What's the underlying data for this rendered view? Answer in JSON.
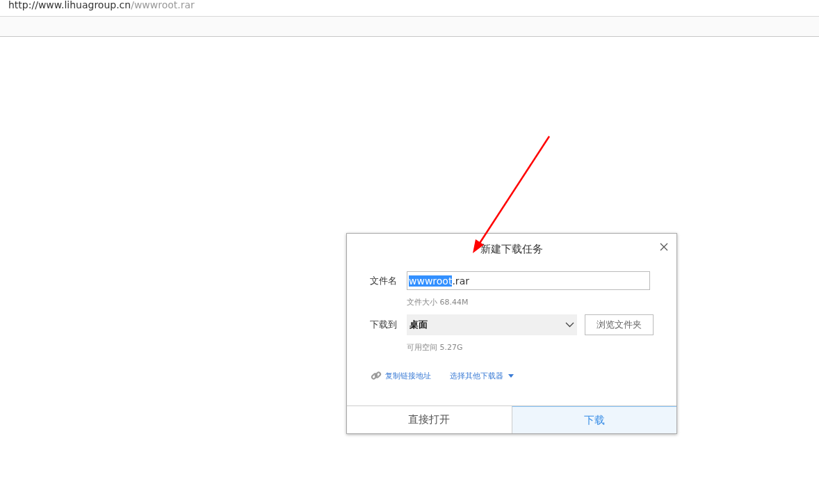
{
  "address_bar": {
    "host": "http://www.lihuagroup.cn",
    "path": "/wwwroot.rar"
  },
  "dialog": {
    "title": "新建下载任务",
    "filename": {
      "label": "文件名",
      "selected_text": "wwwroot",
      "rest_text": ".rar"
    },
    "file_size": "文件大小 68.44M",
    "save_to": {
      "label": "下载到",
      "value": "桌面",
      "browse_button": "浏览文件夹"
    },
    "free_space": "可用空间 5.27G",
    "links": [
      {
        "kind": "copy",
        "label": "复制链接地址"
      },
      {
        "kind": "menu",
        "label": "选择其他下载器"
      }
    ],
    "buttons": [
      {
        "label": "直接打开",
        "selected": false
      },
      {
        "label": "下载",
        "selected": true
      }
    ]
  }
}
